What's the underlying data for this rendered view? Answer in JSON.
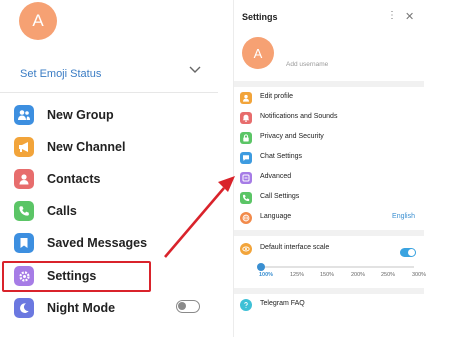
{
  "left_panel": {
    "avatar_letter": "A",
    "emoji_status": "Set Emoji Status",
    "menu": [
      {
        "label": "New Group",
        "icon": "group-icon",
        "color": "#3d8fe0"
      },
      {
        "label": "New Channel",
        "icon": "channel-icon",
        "color": "#f2a43a"
      },
      {
        "label": "Contacts",
        "icon": "contacts-icon",
        "color": "#e76d6d"
      },
      {
        "label": "Calls",
        "icon": "phone-icon",
        "color": "#5bc566"
      },
      {
        "label": "Saved Messages",
        "icon": "bookmark-icon",
        "color": "#3d8fe0"
      },
      {
        "label": "Settings",
        "icon": "gear-icon",
        "color": "#a67ce6"
      },
      {
        "label": "Night Mode",
        "icon": "moon-icon",
        "color": "#6b78e0"
      }
    ],
    "night_mode_on": false
  },
  "settings_panel": {
    "title": "Settings",
    "avatar_letter": "A",
    "username_placeholder": "Add username",
    "items": [
      {
        "label": "Edit profile",
        "icon": "profile-icon",
        "color": "#f2a43a"
      },
      {
        "label": "Notifications and Sounds",
        "icon": "bell-icon",
        "color": "#e76d6d"
      },
      {
        "label": "Privacy and Security",
        "icon": "lock-icon",
        "color": "#5bc566"
      },
      {
        "label": "Chat Settings",
        "icon": "chat-icon",
        "color": "#3d9be0"
      },
      {
        "label": "Advanced",
        "icon": "advanced-icon",
        "color": "#a67ce6"
      },
      {
        "label": "Call Settings",
        "icon": "phone-icon",
        "color": "#5bc566"
      },
      {
        "label": "Language",
        "icon": "globe-icon",
        "color": "#f28a4a",
        "value": "English"
      }
    ],
    "scale": {
      "label": "Default interface scale",
      "enabled": true,
      "options": [
        "100%",
        "125%",
        "150%",
        "200%",
        "250%",
        "300%"
      ],
      "selected_index": 0
    },
    "faq_label": "Telegram FAQ",
    "faq_color": "#3ec0d6"
  },
  "highlight_color": "#d9232b"
}
